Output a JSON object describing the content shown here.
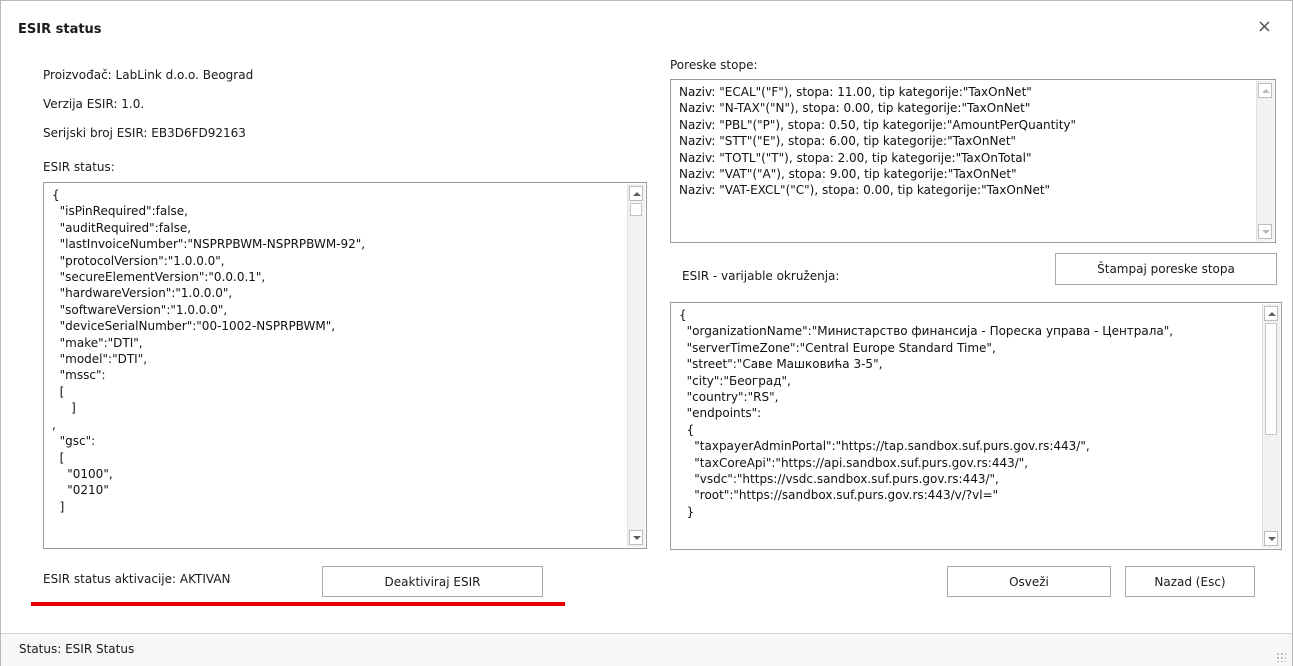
{
  "window": {
    "title": "ESIR status",
    "close_label": "×"
  },
  "info": {
    "manufacturer": "Proizvođač: LabLink d.o.o. Beograd",
    "version": "Verzija ESIR: 1.0.",
    "serial": "Serijski broj ESIR: EB3D6FD92163",
    "status_label": "ESIR status:"
  },
  "esir_status_json": "{\n  \"isPinRequired\":false,\n  \"auditRequired\":false,\n  \"lastInvoiceNumber\":\"NSPRPBWM-NSPRPBWM-92\",\n  \"protocolVersion\":\"1.0.0.0\",\n  \"secureElementVersion\":\"0.0.0.1\",\n  \"hardwareVersion\":\"1.0.0.0\",\n  \"softwareVersion\":\"1.0.0.0\",\n  \"deviceSerialNumber\":\"00-1002-NSPRPBWM\",\n  \"make\":\"DTI\",\n  \"model\":\"DTI\",\n  \"mssc\":\n  [\n     ]\n,\n  \"gsc\":\n  [\n    \"0100\",\n    \"0210\"\n  ]",
  "tax_rates": {
    "label": "Poreske stope:",
    "text": "Naziv: \"ECAL\"(\"F\"), stopa: 11.00, tip kategorije:\"TaxOnNet\"\nNaziv: \"N-TAX\"(\"N\"), stopa: 0.00, tip kategorije:\"TaxOnNet\"\nNaziv: \"PBL\"(\"P\"), stopa: 0.50, tip kategorije:\"AmountPerQuantity\"\nNaziv: \"STT\"(\"E\"), stopa: 6.00, tip kategorije:\"TaxOnNet\"\nNaziv: \"TOTL\"(\"T\"), stopa: 2.00, tip kategorije:\"TaxOnTotal\"\nNaziv: \"VAT\"(\"A\"), stopa: 9.00, tip kategorije:\"TaxOnNet\"\nNaziv: \"VAT-EXCL\"(\"C\"), stopa: 0.00, tip kategorije:\"TaxOnNet\"",
    "print_button": "Štampaj poreske stopa"
  },
  "environment": {
    "label": "ESIR - varijable okruženja:",
    "text": "{\n  \"organizationName\":\"Министарство финансија - Пореска управа - Централа\",\n  \"serverTimeZone\":\"Central Europe Standard Time\",\n  \"street\":\"Саве Машковића 3-5\",\n  \"city\":\"Београд\",\n  \"country\":\"RS\",\n  \"endpoints\":\n  {\n    \"taxpayerAdminPortal\":\"https://tap.sandbox.suf.purs.gov.rs:443/\",\n    \"taxCoreApi\":\"https://api.sandbox.suf.purs.gov.rs:443/\",\n    \"vsdc\":\"https://vsdc.sandbox.suf.purs.gov.rs:443/\",\n    \"root\":\"https://sandbox.suf.purs.gov.rs:443/v/?vl=\"\n  }"
  },
  "activation": {
    "status_text": "ESIR status aktivacije: AKTIVAN",
    "deactivate_button": "Deaktiviraj ESIR"
  },
  "actions": {
    "refresh_button": "Osveži",
    "back_button": "Nazad (Esc)"
  },
  "statusbar": {
    "text": "Status: ESIR Status"
  },
  "colors": {
    "highlight_underline": "#e60000"
  },
  "icons": [
    "close-icon",
    "scroll-up-icon",
    "scroll-down-icon",
    "resize-grip-icon"
  ]
}
